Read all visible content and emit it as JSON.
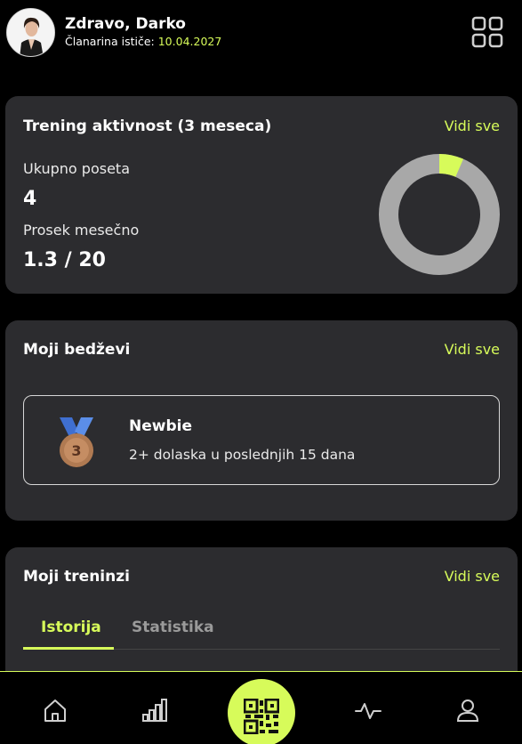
{
  "header": {
    "greeting": "Zdravo, Darko",
    "membership_label": "Članarina ističe:",
    "membership_date": "10.04.2027",
    "menu_icon": "grid-icon"
  },
  "activity": {
    "title": "Trening aktivnost (3 meseca)",
    "see_all": "Vidi sve",
    "total_label": "Ukupno poseta",
    "total_value": "4",
    "avg_label": "Prosek mesečno",
    "avg_value": "1.3 / 20",
    "progress_fraction": 0.065,
    "colors": {
      "track": "#a8a8a8",
      "fill": "#d7fb5a"
    }
  },
  "badges": {
    "title": "Moji bedževi",
    "see_all": "Vidi sve",
    "items": [
      {
        "name": "Newbie",
        "description": "2+ dolaska u poslednjih 15 dana",
        "icon": "medal-icon",
        "rank": "3"
      }
    ]
  },
  "trainings": {
    "title": "Moji treninzi",
    "see_all": "Vidi sve",
    "tabs": [
      {
        "label": "Istorija",
        "active": true
      },
      {
        "label": "Statistika",
        "active": false
      }
    ]
  },
  "nav": {
    "items": [
      "home-icon",
      "bar-chart-icon",
      "qr-code-icon",
      "activity-icon",
      "user-icon"
    ],
    "accent": "#d7fb5a"
  }
}
